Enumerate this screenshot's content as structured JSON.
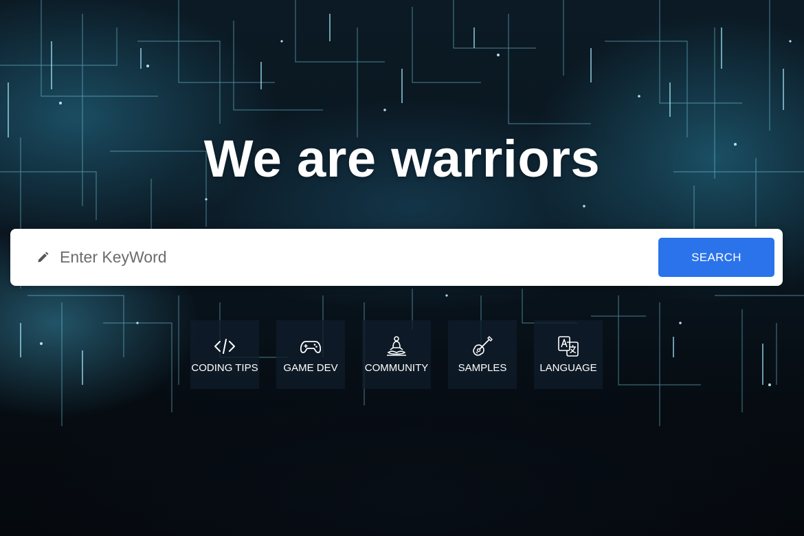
{
  "hero": {
    "title": "We are warriors"
  },
  "search": {
    "placeholder": "Enter KeyWord",
    "value": "",
    "button_label": "SEARCH",
    "icon": "pencil-icon"
  },
  "categories": [
    {
      "label": "CODING TIPS",
      "icon": "code-icon"
    },
    {
      "label": "GAME DEV",
      "icon": "gamepad-icon"
    },
    {
      "label": "COMMUNITY",
      "icon": "meditation-icon"
    },
    {
      "label": "SAMPLES",
      "icon": "guitar-icon"
    },
    {
      "label": "LANGUAGE",
      "icon": "translate-icon"
    }
  ],
  "colors": {
    "accent": "#2a73ea",
    "tile_background": "#101c2a",
    "text": "#ffffff",
    "network_lines": "#7fd8f0"
  }
}
